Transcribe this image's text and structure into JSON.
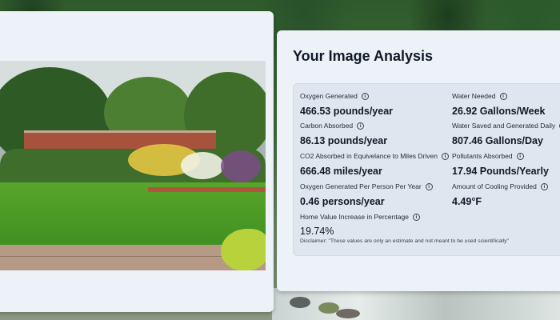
{
  "page": {
    "title": "Your Image Analysis",
    "image_alt": "Garden"
  },
  "stats": {
    "oxygen_generated": {
      "label": "Oxygen Generated",
      "value": "466.53 pounds/year"
    },
    "water_needed": {
      "label": "Water Needed",
      "value": "26.92 Gallons/Week"
    },
    "carbon_absorbed": {
      "label": "Carbon Absorbed",
      "value": "86.13 pounds/year"
    },
    "water_saved": {
      "label": "Water Saved and Generated Daily",
      "value": "807.46 Gallons/Day"
    },
    "co2_miles": {
      "label": "CO2 Absorbed in Equivelance to Miles Driven",
      "value": "666.48 miles/year"
    },
    "pollutants_absorbed": {
      "label": "Pollutants Absorbed",
      "value": "17.94 Pounds/Yearly"
    },
    "oxygen_per_person": {
      "label": "Oxygen Generated Per Person Per Year",
      "value": "0.46 persons/year"
    },
    "cooling_provided": {
      "label": "Amount of Cooling Provided",
      "value": "4.49°F"
    },
    "home_value": {
      "label": "Home Value Increase in Percentage",
      "value": "19.74%"
    }
  },
  "disclaimer": "Disclaimer: \"These values are only an estimate and not meant to be used scientifically\"",
  "icons": {
    "info": "info-icon"
  },
  "colors": {
    "panel_bg": "#edf2f8",
    "stats_bg": "#dfe6ef",
    "text": "#111827"
  }
}
